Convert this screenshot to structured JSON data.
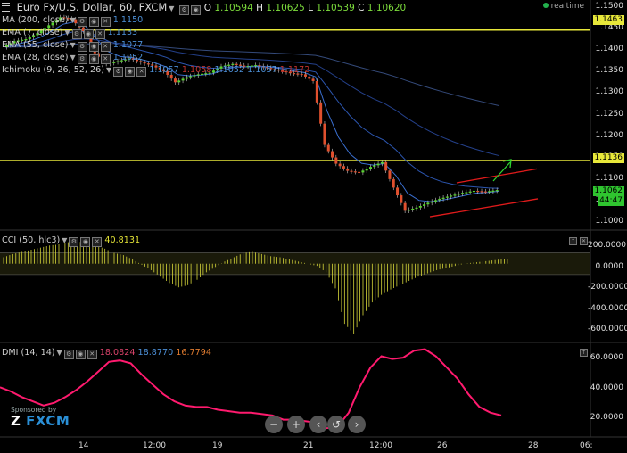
{
  "header": {
    "menu_icon": "hamburger-icon",
    "symbol": "Euro Fx/U.S. Dollar, 60, FXCM",
    "o_label": "O",
    "o_value": "1.10594",
    "h_label": "H",
    "h_value": "1.10625",
    "l_label": "L",
    "l_value": "1.10539",
    "c_label": "C",
    "c_value": "1.10620",
    "realtime_label": "realtime"
  },
  "indicators": {
    "ma": {
      "label": "MA (200, close)",
      "value": "1.1150"
    },
    "ema7": {
      "label": "EMA (7, close)",
      "value": "1.1133"
    },
    "ema55": {
      "label": "EMA (55, close)",
      "value": "1.1077"
    },
    "ema28": {
      "label": "EMA (28, close)",
      "value": "1.1052"
    },
    "ichimoku": {
      "label": "Ichimoku (9, 26, 52, 26)",
      "v1": "1.1057",
      "v2": "1.1058",
      "v3": "1.1052",
      "v4": "1.1057",
      "v5": "1.1172"
    }
  },
  "cci": {
    "label": "CCI (50, hlc3)",
    "value": "40.8131"
  },
  "dmi": {
    "label": "DMI (14, 14)",
    "v1": "18.0824",
    "v2": "18.8770",
    "v3": "16.7794"
  },
  "price_axis": [
    "1.1500",
    "1.1450",
    "1.1400",
    "1.1350",
    "1.1300",
    "1.1250",
    "1.1200",
    "1.1150",
    "1.1100",
    "1.1050",
    "1.1000"
  ],
  "price_tags": {
    "upper": "1.1463",
    "lower": "1.1136",
    "current": "1.1062",
    "countdown": "44:47"
  },
  "cci_axis": [
    "200.0000",
    "0.0000",
    "-200.0000",
    "-400.0000",
    "-600.0000"
  ],
  "dmi_axis": [
    "60.0000",
    "40.0000",
    "20.0000"
  ],
  "time_axis": [
    "14",
    "12:00",
    "19",
    "21",
    "12:00",
    "26",
    "28",
    "06:"
  ],
  "sponsor": {
    "text": "Sponsored by",
    "brand": "FXCM"
  },
  "nav_icons": [
    "zoom-out-icon",
    "zoom-in-icon",
    "scroll-left-icon",
    "reset-icon",
    "scroll-right-icon"
  ],
  "colors": {
    "support": "#e8e83a",
    "channel": "#e01b1b",
    "arrow": "#2fd42f",
    "candle_up": "#58d42f",
    "candle_down": "#e0502e",
    "cci": "#d6d63a",
    "dmi": "#ff1a6e"
  },
  "chart_data": [
    {
      "type": "candlestick",
      "title": "Euro Fx/U.S. Dollar, 60, FXCM",
      "ylim": [
        1.0975,
        1.1525
      ],
      "horizontal_lines": [
        1.1463,
        1.1136
      ],
      "close_path": [
        1.142,
        1.1435,
        1.144,
        1.1455,
        1.1475,
        1.1495,
        1.149,
        1.146,
        1.1405,
        1.1378,
        1.1385,
        1.1392,
        1.1382,
        1.1374,
        1.136,
        1.1332,
        1.1345,
        1.1352,
        1.1356,
        1.1372,
        1.1378,
        1.1372,
        1.1375,
        1.1368,
        1.1362,
        1.1355,
        1.1352,
        1.1335,
        1.1175,
        1.1128,
        1.111,
        1.1106,
        1.112,
        1.1132,
        1.1068,
        1.101,
        1.1018,
        1.103,
        1.104,
        1.1048,
        1.1055,
        1.106,
        1.1058,
        1.1062
      ],
      "channel_lines": [
        [
          1.108,
          1.1115
        ],
        [
          1.0995,
          1.104
        ]
      ]
    },
    {
      "type": "bar",
      "title": "CCI (50, hlc3)",
      "ylim": [
        -700,
        280
      ],
      "values": [
        60,
        90,
        110,
        130,
        150,
        170,
        180,
        200,
        210,
        190,
        170,
        140,
        100,
        80,
        40,
        -10,
        -60,
        -120,
        -180,
        -220,
        -200,
        -150,
        -80,
        -30,
        20,
        60,
        100,
        110,
        90,
        70,
        60,
        40,
        20,
        0,
        -20,
        -80,
        -230,
        -560,
        -650,
        -480,
        -360,
        -290,
        -240,
        -200,
        -160,
        -120,
        -90,
        -60,
        -40,
        -20,
        0,
        10,
        20,
        30,
        40
      ]
    },
    {
      "type": "line",
      "title": "DMI (14, 14)",
      "ylim": [
        4,
        66
      ],
      "values": [
        38,
        35,
        31,
        28,
        25,
        27,
        31,
        36,
        42,
        49,
        56,
        57,
        55,
        47,
        40,
        33,
        28,
        25,
        24,
        24,
        22,
        21,
        20,
        20,
        19,
        18,
        15,
        15,
        14,
        13,
        9,
        10,
        20,
        38,
        52,
        60,
        58,
        59,
        64,
        65,
        60,
        52,
        44,
        33,
        24,
        20,
        18
      ]
    }
  ]
}
